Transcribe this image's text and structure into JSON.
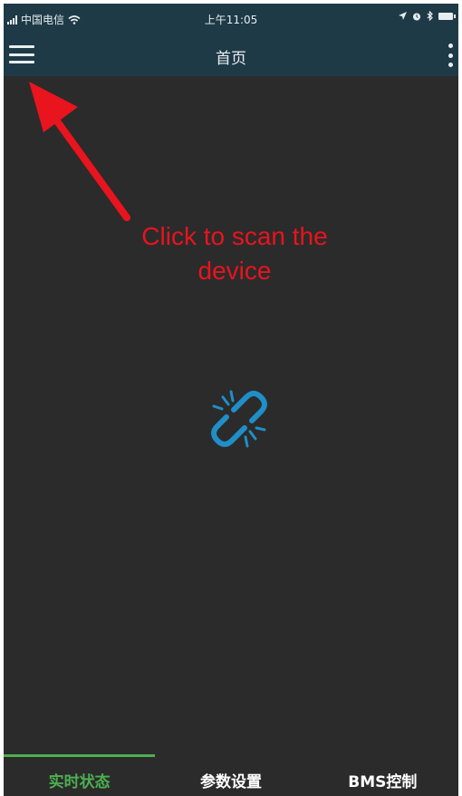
{
  "status_bar": {
    "carrier": "中国电信",
    "time": "上午11:05",
    "icons": [
      "signal-icon",
      "wifi-icon",
      "location-icon",
      "alarm-icon",
      "bluetooth-icon",
      "battery-icon"
    ]
  },
  "app_bar": {
    "title": "首页",
    "menu_icon": "hamburger-menu-icon",
    "overflow_icon": "more-vertical-icon"
  },
  "main": {
    "annotation_line1": "Click to scan the",
    "annotation_line2": "device",
    "status_icon": "disconnected-link-icon"
  },
  "tabs": [
    {
      "label": "实时状态",
      "active": true
    },
    {
      "label": "参数设置",
      "active": false
    },
    {
      "label": "BMS控制",
      "active": false
    }
  ],
  "colors": {
    "app_bar": "#1e3a47",
    "background": "#2b2b2b",
    "accent": "#4caf50",
    "annotation": "#e8141e",
    "link_icon": "#1f8ec9"
  }
}
